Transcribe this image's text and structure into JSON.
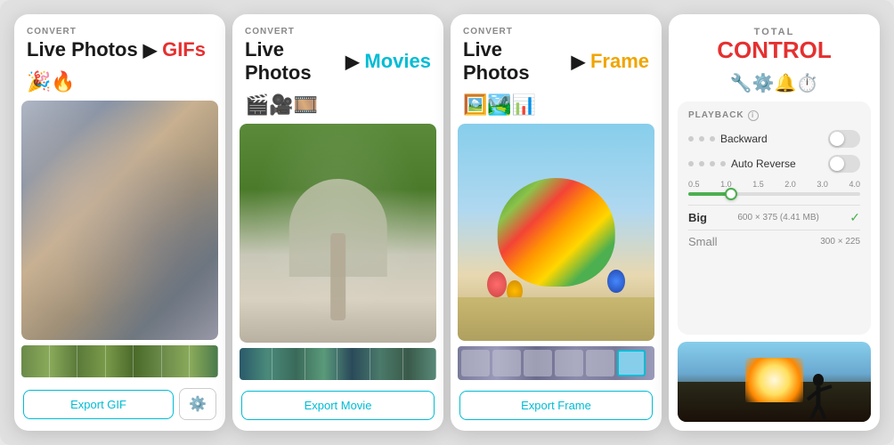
{
  "screens": [
    {
      "id": "gif-screen",
      "convert_label": "CONVERT",
      "title_live": "Live Photos",
      "arrow": "▶",
      "title_target": "GIFs",
      "title_target_class": "title-target-gif",
      "icons": "🎉🔥",
      "export_btn": "Export GIF",
      "has_settings": true,
      "filmstrip_class": "filmstrip-gif"
    },
    {
      "id": "movie-screen",
      "convert_label": "CONVERT",
      "title_live": "Live Photos",
      "arrow": "▶",
      "title_target": "Movies",
      "title_target_class": "title-target-movie",
      "icons": "🎬🎥🎞️",
      "export_btn": "Export Movie",
      "has_settings": false,
      "filmstrip_class": "filmstrip-movie"
    },
    {
      "id": "frame-screen",
      "convert_label": "CONVERT",
      "title_live": "Live Photos",
      "arrow": "▶",
      "title_target": "Frame",
      "title_target_class": "title-target-frame",
      "icons": "🖼️🏞️📊",
      "export_btn": "Export Frame",
      "has_settings": false,
      "filmstrip_class": "filmstrip-frame"
    }
  ],
  "control_screen": {
    "total_label": "TOTAL",
    "title": "CONTROL",
    "icons": "🔧⚙️🔔⏱️",
    "playback_label": "PLAYBACK",
    "backward_label": "Backward",
    "auto_reverse_label": "Auto Reverse",
    "slider_values": [
      "0.5",
      "1.0",
      "1.5",
      "2.0",
      "3.0",
      "4.0"
    ],
    "size_big_label": "Big",
    "size_big_value": "600 × 375 (4.41 MB)",
    "size_small_label": "Small",
    "size_small_value": "300 × 225"
  }
}
